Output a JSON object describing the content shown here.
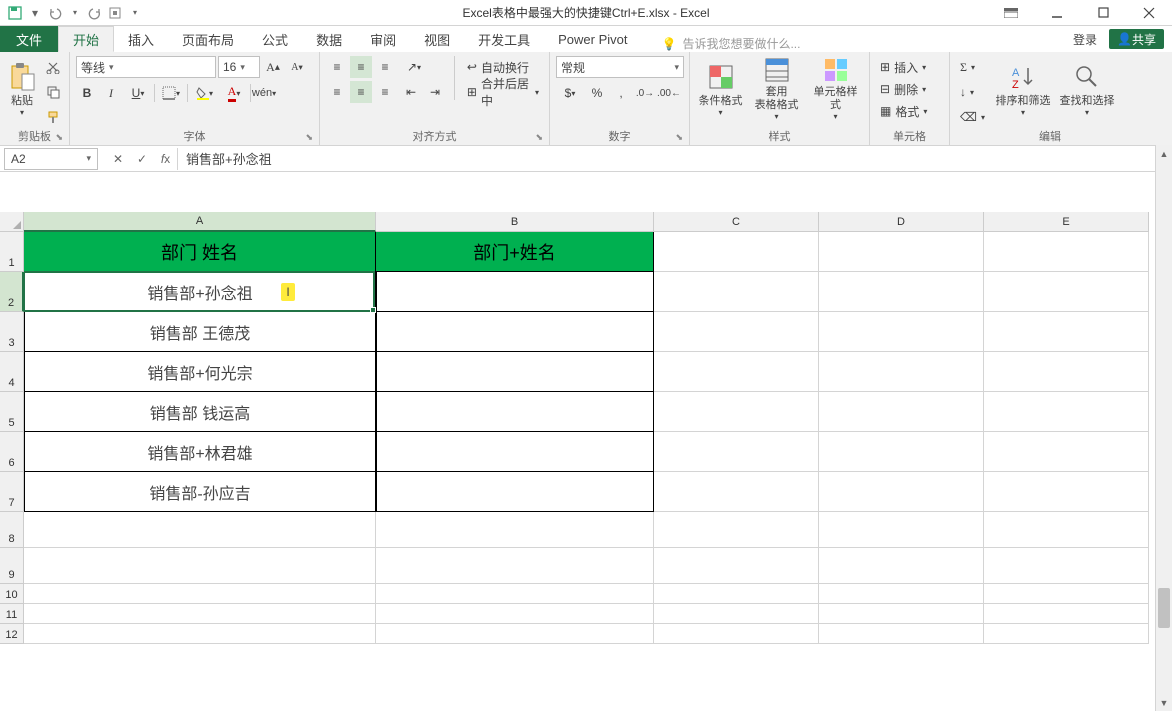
{
  "title": "Excel表格中最强大的快捷键Ctrl+E.xlsx - Excel",
  "qat": {
    "save": "保存",
    "undo": "撤消",
    "redo": "恢复"
  },
  "tabs": {
    "file": "文件",
    "home": "开始",
    "insert": "插入",
    "pagelayout": "页面布局",
    "formulas": "公式",
    "data": "数据",
    "review": "审阅",
    "view": "视图",
    "developer": "开发工具",
    "powerpivot": "Power Pivot"
  },
  "tellme": "告诉我您想要做什么...",
  "login": "登录",
  "share": "共享",
  "ribbon": {
    "clipboard": {
      "label": "剪贴板",
      "paste": "粘贴"
    },
    "font": {
      "label": "字体",
      "name": "等线",
      "size": "16",
      "bold": "B",
      "italic": "I",
      "underline": "U"
    },
    "align": {
      "label": "对齐方式",
      "wrap": "自动换行",
      "merge": "合并后居中"
    },
    "number": {
      "label": "数字",
      "format": "常规"
    },
    "styles": {
      "label": "样式",
      "cond": "条件格式",
      "table": "套用\n表格格式",
      "cell": "单元格样式"
    },
    "cells": {
      "label": "单元格",
      "insert": "插入",
      "delete": "删除",
      "format": "格式"
    },
    "editing": {
      "label": "编辑",
      "sort": "排序和筛选",
      "find": "查找和选择"
    }
  },
  "namebox": "A2",
  "formula": "销售部+孙念祖",
  "columns": [
    "A",
    "B",
    "C",
    "D",
    "E"
  ],
  "rows": [
    "1",
    "2",
    "3",
    "4",
    "5",
    "6",
    "7",
    "8",
    "9",
    "10",
    "11",
    "12"
  ],
  "data": {
    "header": {
      "A": "部门 姓名",
      "B": "部门+姓名"
    },
    "body": [
      {
        "A": "销售部+孙念祖",
        "B": ""
      },
      {
        "A": "销售部 王德茂",
        "B": ""
      },
      {
        "A": "销售部+何光宗",
        "B": ""
      },
      {
        "A": "销售部 钱运高",
        "B": ""
      },
      {
        "A": "销售部+林君雄",
        "B": ""
      },
      {
        "A": "销售部-孙应吉",
        "B": ""
      }
    ]
  }
}
